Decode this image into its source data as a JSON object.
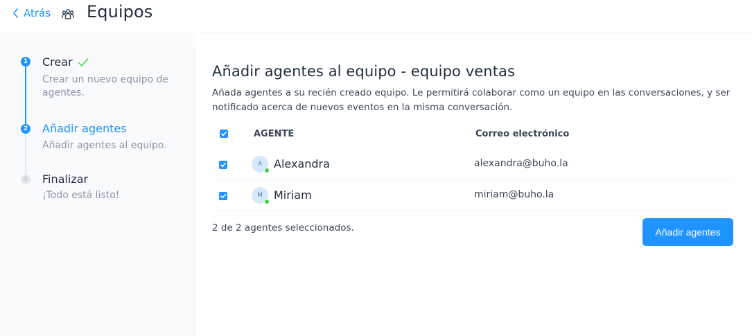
{
  "header": {
    "back_label": "Atrás",
    "title": "Equipos",
    "team_icon": "team-icon"
  },
  "steps": [
    {
      "number": "1",
      "title": "Crear",
      "description": "Crear un nuevo equipo de agentes.",
      "state": "done"
    },
    {
      "number": "2",
      "title": "Añadir agentes",
      "description": "Añadir agentes al equipo.",
      "state": "active"
    },
    {
      "number": "3",
      "title": "Finalizar",
      "description": "¡Todo está listo!",
      "state": "pending"
    }
  ],
  "main": {
    "title": "Añadir agentes al equipo - equipo ventas",
    "description": "Añada agentes a su recién creado equipo. Le permitirá colaborar como un equipo en las conversaciones, y ser notificado acerca de nuevos eventos en la misma conversación.",
    "table": {
      "headers": {
        "agent": "AGENTE",
        "email": "Correo electrónico"
      },
      "rows": [
        {
          "initial": "A",
          "name": "Alexandra",
          "email": "alexandra@buho.la",
          "checked": true,
          "online": true
        },
        {
          "initial": "M",
          "name": "Miriam",
          "email": "miriam@buho.la",
          "checked": true,
          "online": true
        }
      ]
    },
    "selected_summary": "2 de 2 agentes seleccionados.",
    "submit_label": "Añadir agentes"
  },
  "colors": {
    "accent": "#1f93ff",
    "online": "#44ce4b",
    "sidebar_bg": "#f9fafc"
  }
}
